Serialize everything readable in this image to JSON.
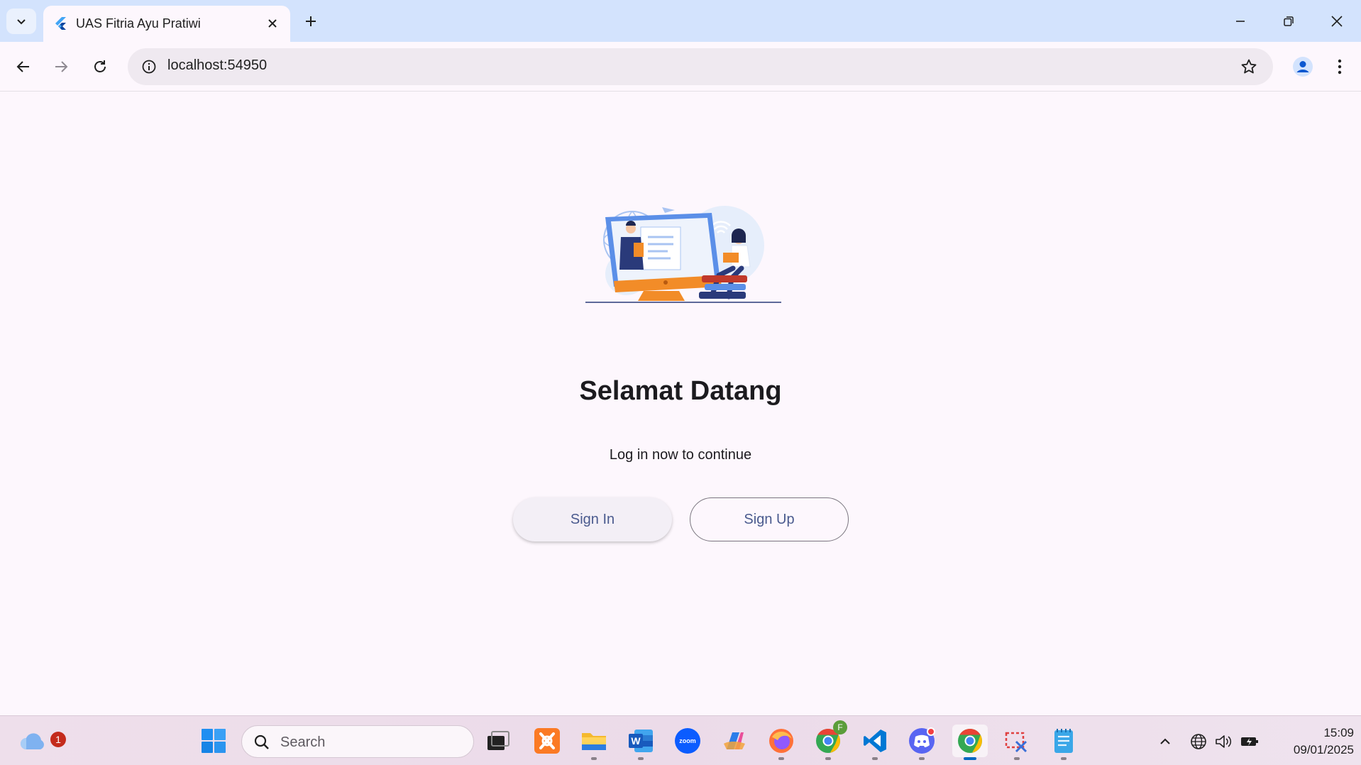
{
  "browser": {
    "tab_title": "UAS Fitria Ayu Pratiwi",
    "url": "localhost:54950"
  },
  "page": {
    "title": "Selamat Datang",
    "subtitle": "Log in now to continue",
    "sign_in_label": "Sign In",
    "sign_up_label": "Sign Up"
  },
  "taskbar": {
    "weather_badge": "1",
    "search_placeholder": "Search",
    "chrome_profile_badge": "F",
    "time": "15:09",
    "date": "09/01/2025"
  },
  "colors": {
    "tab_strip": "#d3e3fd",
    "page_background": "#fdf7fd",
    "button_text": "#4a5a8e",
    "hero_orange": "#f28c28",
    "hero_navy": "#2a3a7a",
    "hero_blue": "#5b8fe8"
  },
  "icons": {
    "tabstrip": [
      "chevron-down-icon",
      "flutter-icon",
      "close-icon",
      "plus-icon",
      "minimize-icon",
      "restore-icon",
      "window-close-icon"
    ],
    "toolbar": [
      "back-arrow-icon",
      "forward-arrow-icon",
      "reload-icon",
      "info-icon",
      "star-icon",
      "profile-icon",
      "more-vert-icon"
    ],
    "taskbar": [
      "weather-icon",
      "windows-start-icon",
      "search-icon",
      "task-view-icon",
      "xampp-icon",
      "file-explorer-icon",
      "word-icon",
      "zoom-icon",
      "copilot-icon",
      "firefox-icon",
      "chrome-icon",
      "vscode-icon",
      "discord-icon",
      "snipping-tool-icon",
      "notepad-icon"
    ],
    "tray": [
      "chevron-up-icon",
      "network-icon",
      "volume-icon",
      "battery-icon"
    ]
  }
}
